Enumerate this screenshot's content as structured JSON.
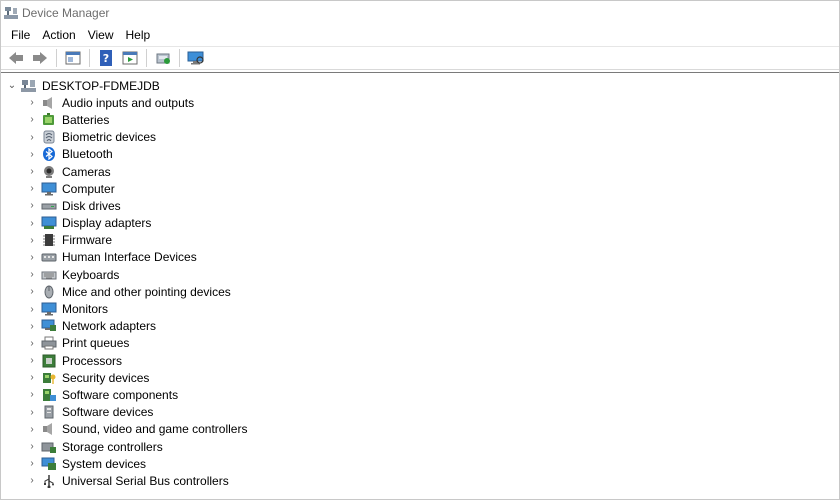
{
  "window": {
    "title": "Device Manager"
  },
  "menu": [
    "File",
    "Action",
    "View",
    "Help"
  ],
  "toolbar": {
    "buttons": [
      "back-icon",
      "forward-icon",
      "properties-icon",
      "help-icon",
      "run-icon",
      "update-driver-icon",
      "scan-hardware-icon"
    ]
  },
  "tree": {
    "root": {
      "label": "DESKTOP-FDMEJDB",
      "icon": "computer-tower-icon"
    },
    "categories": [
      {
        "label": "Audio inputs and outputs",
        "icon": "speaker-icon"
      },
      {
        "label": "Batteries",
        "icon": "battery-icon"
      },
      {
        "label": "Biometric devices",
        "icon": "biometric-icon"
      },
      {
        "label": "Bluetooth",
        "icon": "bluetooth-icon"
      },
      {
        "label": "Cameras",
        "icon": "camera-icon"
      },
      {
        "label": "Computer",
        "icon": "monitor-icon"
      },
      {
        "label": "Disk drives",
        "icon": "disk-drive-icon"
      },
      {
        "label": "Display adapters",
        "icon": "display-adapter-icon"
      },
      {
        "label": "Firmware",
        "icon": "firmware-icon"
      },
      {
        "label": "Human Interface Devices",
        "icon": "hid-icon"
      },
      {
        "label": "Keyboards",
        "icon": "keyboard-icon"
      },
      {
        "label": "Mice and other pointing devices",
        "icon": "mouse-icon"
      },
      {
        "label": "Monitors",
        "icon": "monitor-icon"
      },
      {
        "label": "Network adapters",
        "icon": "network-adapter-icon"
      },
      {
        "label": "Print queues",
        "icon": "printer-icon"
      },
      {
        "label": "Processors",
        "icon": "processor-icon"
      },
      {
        "label": "Security devices",
        "icon": "security-icon"
      },
      {
        "label": "Software components",
        "icon": "software-component-icon"
      },
      {
        "label": "Software devices",
        "icon": "software-device-icon"
      },
      {
        "label": "Sound, video and game controllers",
        "icon": "speaker-icon"
      },
      {
        "label": "Storage controllers",
        "icon": "storage-controller-icon"
      },
      {
        "label": "System devices",
        "icon": "system-device-icon"
      },
      {
        "label": "Universal Serial Bus controllers",
        "icon": "usb-icon"
      }
    ]
  }
}
